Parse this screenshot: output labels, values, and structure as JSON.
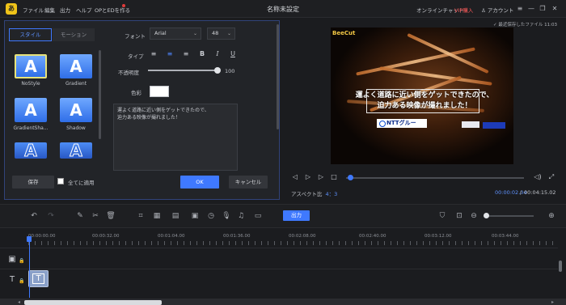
{
  "app": {
    "logo_glyph": "あ",
    "window_title": "名称未設定",
    "menu": [
      "ファイル",
      "編集",
      "出力",
      "ヘルプ",
      "OPとEDを作る"
    ],
    "online_chat": "オンラインチャット",
    "vip": "VIP購入",
    "account": "アカウント",
    "save_status": "最近保存したファイル 11:03",
    "colors": {
      "accent": "#3f79ff",
      "vip": "#ff5a5a",
      "logo": "#f0c419"
    }
  },
  "text_panel": {
    "tabs": [
      "スタイル",
      "モーション"
    ],
    "styles": [
      {
        "label": "NoStyle",
        "glyph": "A"
      },
      {
        "label": "Gradient",
        "glyph": "A"
      },
      {
        "label": "GradientSha...",
        "glyph": "A"
      },
      {
        "label": "Shadow",
        "glyph": "A"
      },
      {
        "label": "",
        "glyph": "A"
      },
      {
        "label": "",
        "glyph": "A"
      }
    ],
    "font_label": "フォント",
    "font_value": "Arial",
    "size_value": "48",
    "type_label": "タイプ",
    "type_buttons": [
      "≡",
      "≡",
      "≡",
      "B",
      "I",
      "U"
    ],
    "opacity_label": "不透明度",
    "opacity_value": "100",
    "opacity_fraction": 1.0,
    "color_label": "色彩",
    "color_value": "#ffffff",
    "text_content": "運よく道路に近い側をゲットできたので、\n迫力ある映像が撮れました！",
    "save_btn": "保存",
    "apply_all": "全てに適用",
    "ok_btn": "OK",
    "cancel_btn": "キャンセル"
  },
  "preview": {
    "watermark": "BeeCut",
    "caption": "運よく道路に近い側をゲットできたので、\n迫力ある映像が撮れました！",
    "ntt_text": "NTTグルー",
    "aspect_label": "アスペクト比",
    "aspect_value": "4：3",
    "time_current": "00:00:02.04",
    "time_separator": "/",
    "time_total": "00:04:15.02",
    "progress_fraction": 0.01
  },
  "toolbar": {
    "export_btn": "出力"
  },
  "timeline": {
    "ruler": [
      "00:00:00.00",
      "00:00:32.00",
      "00:01:04.00",
      "00:01:36.00",
      "00:02:08.00",
      "00:02:40.00",
      "00:03:12.00",
      "00:03:44.00"
    ],
    "text_clip_glyph": "T",
    "lock_glyph": "🔒",
    "video_track_glyph": "▣",
    "text_track_glyph": "T"
  }
}
